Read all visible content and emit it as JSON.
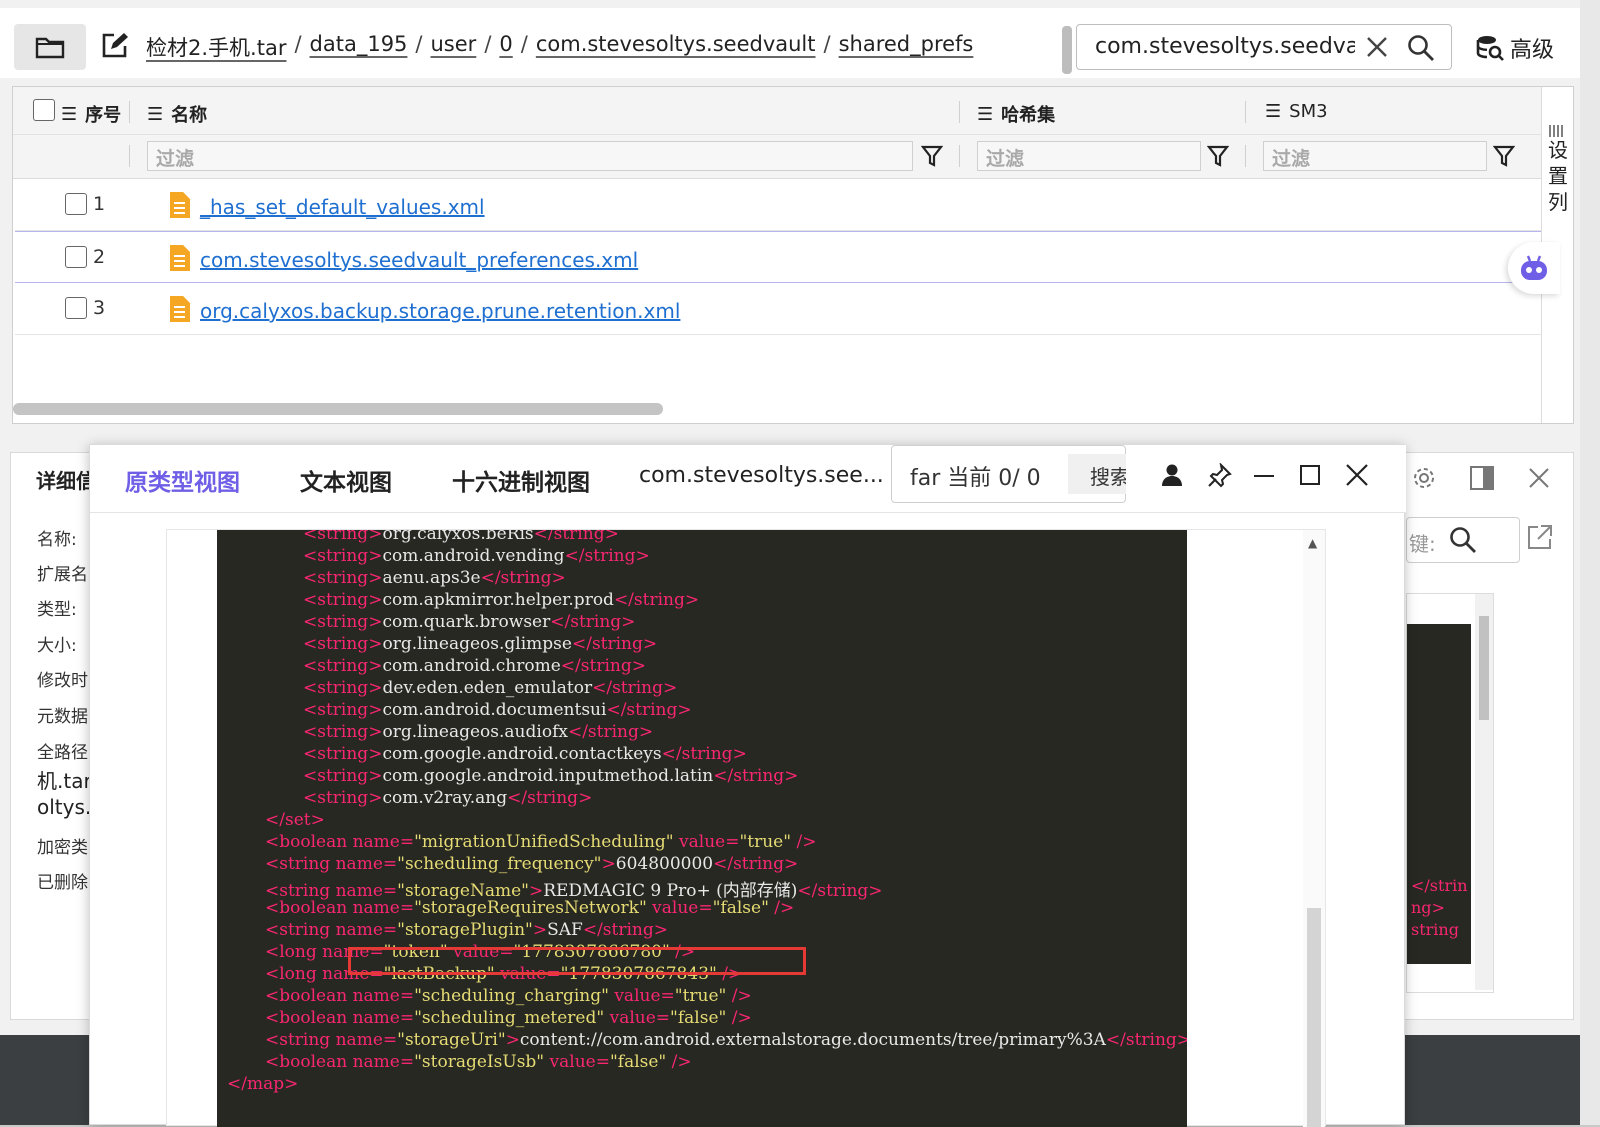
{
  "topbar": {
    "breadcrumb": [
      "检材2.手机.tar",
      "data_195",
      "user",
      "0",
      "com.stevesoltys.seedvault",
      "shared_prefs"
    ],
    "search_value": "com.stevesoltys.seedva",
    "advanced_label": "高级"
  },
  "table": {
    "columns": {
      "index": "序号",
      "name": "名称",
      "hashset": "哈希集",
      "sm3": "SM3"
    },
    "filter_placeholder": "过滤",
    "settings_label": "设置列",
    "rows": [
      {
        "num": "1",
        "name": "_has_set_default_values.xml"
      },
      {
        "num": "2",
        "name": "com.stevesoltys.seedvault_preferences.xml"
      },
      {
        "num": "3",
        "name": "org.calyxos.backup.storage.prune.retention.xml"
      }
    ]
  },
  "details": {
    "title": "详细信",
    "fields": [
      "名称:",
      "扩展名",
      "类型:",
      "大小:",
      "修改时",
      "元数据",
      "全路径",
      "机.tar",
      "oltys.",
      "加密类",
      "已删除"
    ],
    "search_hint": "键:",
    "code_fragments": [
      "</strin",
      "ng>",
      "string"
    ]
  },
  "dialog": {
    "tabs": [
      "原类型视图",
      "文本视图",
      "十六进制视图",
      "com.stevesoltys.see..."
    ],
    "search_query": "far",
    "search_status": "当前  0/ 0",
    "search_button": "搜索",
    "code_lines": [
      {
        "indent": 4,
        "tag": "string",
        "text": "org.calyxos.beRis"
      },
      {
        "indent": 4,
        "tag": "string",
        "text": "com.android.vending"
      },
      {
        "indent": 4,
        "tag": "string",
        "text": "aenu.aps3e"
      },
      {
        "indent": 4,
        "tag": "string",
        "text": "com.apkmirror.helper.prod"
      },
      {
        "indent": 4,
        "tag": "string",
        "text": "com.quark.browser"
      },
      {
        "indent": 4,
        "tag": "string",
        "text": "org.lineageos.glimpse"
      },
      {
        "indent": 4,
        "tag": "string",
        "text": "com.android.chrome"
      },
      {
        "indent": 4,
        "tag": "string",
        "text": "dev.eden.eden_emulator"
      },
      {
        "indent": 4,
        "tag": "string",
        "text": "com.android.documentsui"
      },
      {
        "indent": 4,
        "tag": "string",
        "text": "org.lineageos.audiofx"
      },
      {
        "indent": 4,
        "tag": "string",
        "text": "com.google.android.contactkeys"
      },
      {
        "indent": 4,
        "tag": "string",
        "text": "com.google.android.inputmethod.latin"
      },
      {
        "indent": 4,
        "tag": "string",
        "text": "com.v2ray.ang"
      },
      {
        "indent": 2,
        "close": "set"
      },
      {
        "indent": 2,
        "tag": "boolean",
        "name": "migrationUnifiedScheduling",
        "value": "true"
      },
      {
        "indent": 2,
        "tag": "string",
        "name": "scheduling_frequency",
        "text": "604800000"
      },
      {
        "indent": 2,
        "tag": "string",
        "name": "storageName",
        "text": "REDMAGIC 9 Pro+ (内部存储)"
      },
      {
        "indent": 2,
        "tag": "boolean",
        "name": "storageRequiresNetwork",
        "value": "false"
      },
      {
        "indent": 2,
        "tag": "string",
        "name": "storagePlugin",
        "text": "SAF"
      },
      {
        "indent": 2,
        "tag": "long",
        "name": "token",
        "value": "1778307866780"
      },
      {
        "indent": 2,
        "tag": "long",
        "name": "lastBackup",
        "value": "1778307867843"
      },
      {
        "indent": 2,
        "tag": "boolean",
        "name": "scheduling_charging",
        "value": "true"
      },
      {
        "indent": 2,
        "tag": "boolean",
        "name": "scheduling_metered",
        "value": "false"
      },
      {
        "indent": 2,
        "tag": "string",
        "name": "storageUri",
        "text": "content://com.android.externalstorage.documents/tree/primary%3A"
      },
      {
        "indent": 2,
        "tag": "boolean",
        "name": "storageIsUsb",
        "value": "false"
      },
      {
        "indent": 0,
        "close": "map"
      }
    ]
  },
  "colors": {
    "accent": "#6f5fe6",
    "link": "#1f6fd1",
    "code_bg": "#272822",
    "code_tag": "#f92672",
    "code_string": "#e6db74",
    "highlight": "#e53935"
  }
}
